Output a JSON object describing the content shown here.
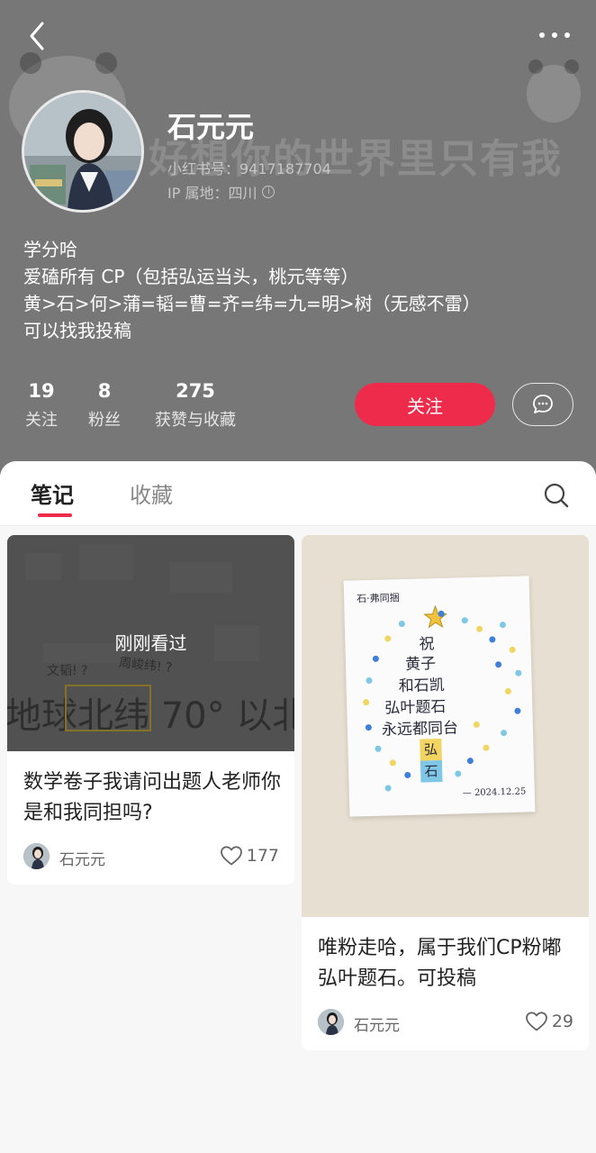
{
  "header": {
    "background_banner": "好想你的世界里只有我",
    "back_icon": "chevron-left-icon",
    "more_icon": "more-horizontal-icon"
  },
  "profile": {
    "name": "石元元",
    "red_id": "小红书号：9417187704",
    "ip_location": "IP 属地：四川",
    "bio": [
      "学分哈",
      "爱磕所有 CP（包括弘运当头，桃元等等）",
      "黄>石>何>蒲=韬=曹=齐=纬=九=明>树（无感不雷）",
      "可以找我投稿"
    ]
  },
  "stats": [
    {
      "value": "19",
      "label": "关注"
    },
    {
      "value": "8",
      "label": "粉丝"
    },
    {
      "value": "275",
      "label": "获赞与收藏"
    }
  ],
  "actions": {
    "follow_label": "关注",
    "message_icon": "chat-bubble-icon"
  },
  "tabs": [
    {
      "label": "笔记",
      "active": true
    },
    {
      "label": "收藏",
      "active": false
    }
  ],
  "search_icon": "search-icon",
  "notes": [
    {
      "title": "数学卷子我请问出题人老师你是和我同担吗?",
      "overlay": "刚刚看过",
      "image_text": {
        "big": "地球北纬 70° 以北",
        "note_left": "文韬! ?",
        "note_right": "周峻纬! ?"
      },
      "author": "石元元",
      "likes": "177"
    },
    {
      "title": "唯粉走哈，属于我们CP粉嘟弘叶题石。可投稿",
      "image_text": {
        "header": "石·弗同捆",
        "lines": [
          "祝",
          "黄子",
          "和石凯",
          "弘叶题石",
          "永远都同台"
        ],
        "stamp": [
          "弘",
          "石"
        ],
        "date": "— 2024.12.25"
      },
      "author": "石元元",
      "likes": "29"
    }
  ],
  "colors": {
    "accent": "#ef2b4b",
    "header_bg": "#777777",
    "page_bg": "#f7f7f7"
  }
}
